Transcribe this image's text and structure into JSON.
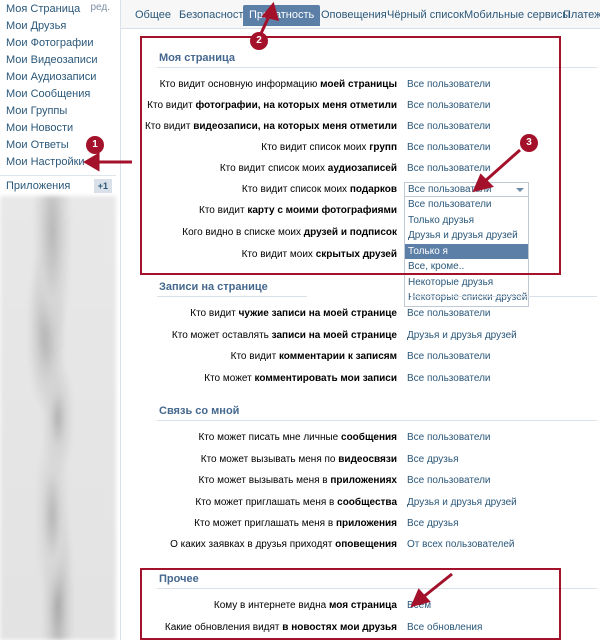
{
  "sidebar": {
    "edit_label": "ред.",
    "items": [
      {
        "label": "Моя Страница"
      },
      {
        "label": "Мои Друзья"
      },
      {
        "label": "Мои Фотографии"
      },
      {
        "label": "Мои Видеозаписи"
      },
      {
        "label": "Мои Аудиозаписи"
      },
      {
        "label": "Мои Сообщения"
      },
      {
        "label": "Мои Группы"
      },
      {
        "label": "Мои Новости"
      },
      {
        "label": "Мои Ответы"
      },
      {
        "label": "Мои Настройки"
      }
    ],
    "apps_label": "Приложения",
    "apps_badge": "+1"
  },
  "tabs": [
    {
      "label": "Общее"
    },
    {
      "label": "Безопасность"
    },
    {
      "label": "Приватность"
    },
    {
      "label": "Оповещения"
    },
    {
      "label": "Чёрный список"
    },
    {
      "label": "Мобильные сервисы"
    },
    {
      "label": "Платежи"
    }
  ],
  "sections": {
    "my_page": {
      "title": "Моя страница",
      "rows": [
        {
          "pre": "Кто видит основную информацию ",
          "bold": "моей страницы",
          "post": "",
          "value": "Все пользователи"
        },
        {
          "pre": "Кто видит ",
          "bold": "фотографии, на которых меня отметили",
          "post": "",
          "value": "Все пользователи"
        },
        {
          "pre": "Кто видит ",
          "bold": "видеозаписи, на которых меня отметили",
          "post": "",
          "value": "Все пользователи"
        },
        {
          "pre": "Кто видит список моих ",
          "bold": "групп",
          "post": "",
          "value": "Все пользователи"
        },
        {
          "pre": "Кто видит список моих ",
          "bold": "аудиозаписей",
          "post": "",
          "value": "Все пользователи"
        },
        {
          "pre": "Кто видит список моих ",
          "bold": "подарков",
          "post": "",
          "value": ""
        },
        {
          "pre": "Кто видит ",
          "bold": "карту с моими фотографиями",
          "post": "",
          "value": ""
        },
        {
          "pre": "Кого видно в списке моих ",
          "bold": "друзей и подписок",
          "post": "",
          "value": ""
        },
        {
          "pre": "Кто видит моих ",
          "bold": "скрытых друзей",
          "post": "",
          "value": ""
        }
      ]
    },
    "wall": {
      "title": "Записи на странице",
      "rows": [
        {
          "pre": "Кто видит ",
          "bold": "чужие записи на моей странице",
          "post": "",
          "value": "Все пользователи"
        },
        {
          "pre": "Кто может оставлять ",
          "bold": "записи на моей странице",
          "post": "",
          "value": "Друзья и друзья друзей"
        },
        {
          "pre": "Кто видит ",
          "bold": "комментарии к записям",
          "post": "",
          "value": "Все пользователи"
        },
        {
          "pre": "Кто может ",
          "bold": "комментировать мои записи",
          "post": "",
          "value": "Все пользователи"
        }
      ]
    },
    "contact": {
      "title": "Связь со мной",
      "rows": [
        {
          "pre": "Кто может писать мне личные ",
          "bold": "сообщения",
          "post": "",
          "value": "Все пользователи"
        },
        {
          "pre": "Кто может вызывать меня по ",
          "bold": "видеосвязи",
          "post": "",
          "value": "Все друзья"
        },
        {
          "pre": "Кто может вызывать меня в ",
          "bold": "приложениях",
          "post": "",
          "value": "Все пользователи"
        },
        {
          "pre": "Кто может приглашать меня в ",
          "bold": "сообщества",
          "post": "",
          "value": "Друзья и друзья друзей"
        },
        {
          "pre": "Кто может приглашать меня в ",
          "bold": "приложения",
          "post": "",
          "value": "Все друзья"
        },
        {
          "pre": "О каких заявках в друзья приходят ",
          "bold": "оповещения",
          "post": "",
          "value": "От всех пользователей"
        }
      ]
    },
    "other": {
      "title": "Прочее",
      "rows": [
        {
          "pre": "Кому в интернете видна ",
          "bold": "моя страница",
          "post": "",
          "value": "Всем"
        },
        {
          "pre": "Какие обновления видят ",
          "bold": "в новостях мои друзья",
          "post": "",
          "value": "Все обновления"
        }
      ]
    }
  },
  "dropdown": {
    "selected": "Все пользователи",
    "options": [
      {
        "label": "Все пользователи"
      },
      {
        "label": "Только друзья"
      },
      {
        "label": "Друзья и друзья друзей"
      },
      {
        "label": "Только я"
      },
      {
        "label": "Все, кроме.."
      },
      {
        "label": "Некоторые друзья"
      },
      {
        "label": "Некоторые списки друзей"
      }
    ],
    "highlighted_index": 3
  },
  "annotations": {
    "step1": "1",
    "step2": "2",
    "step3": "3",
    "accent_color": "#a3112a"
  }
}
